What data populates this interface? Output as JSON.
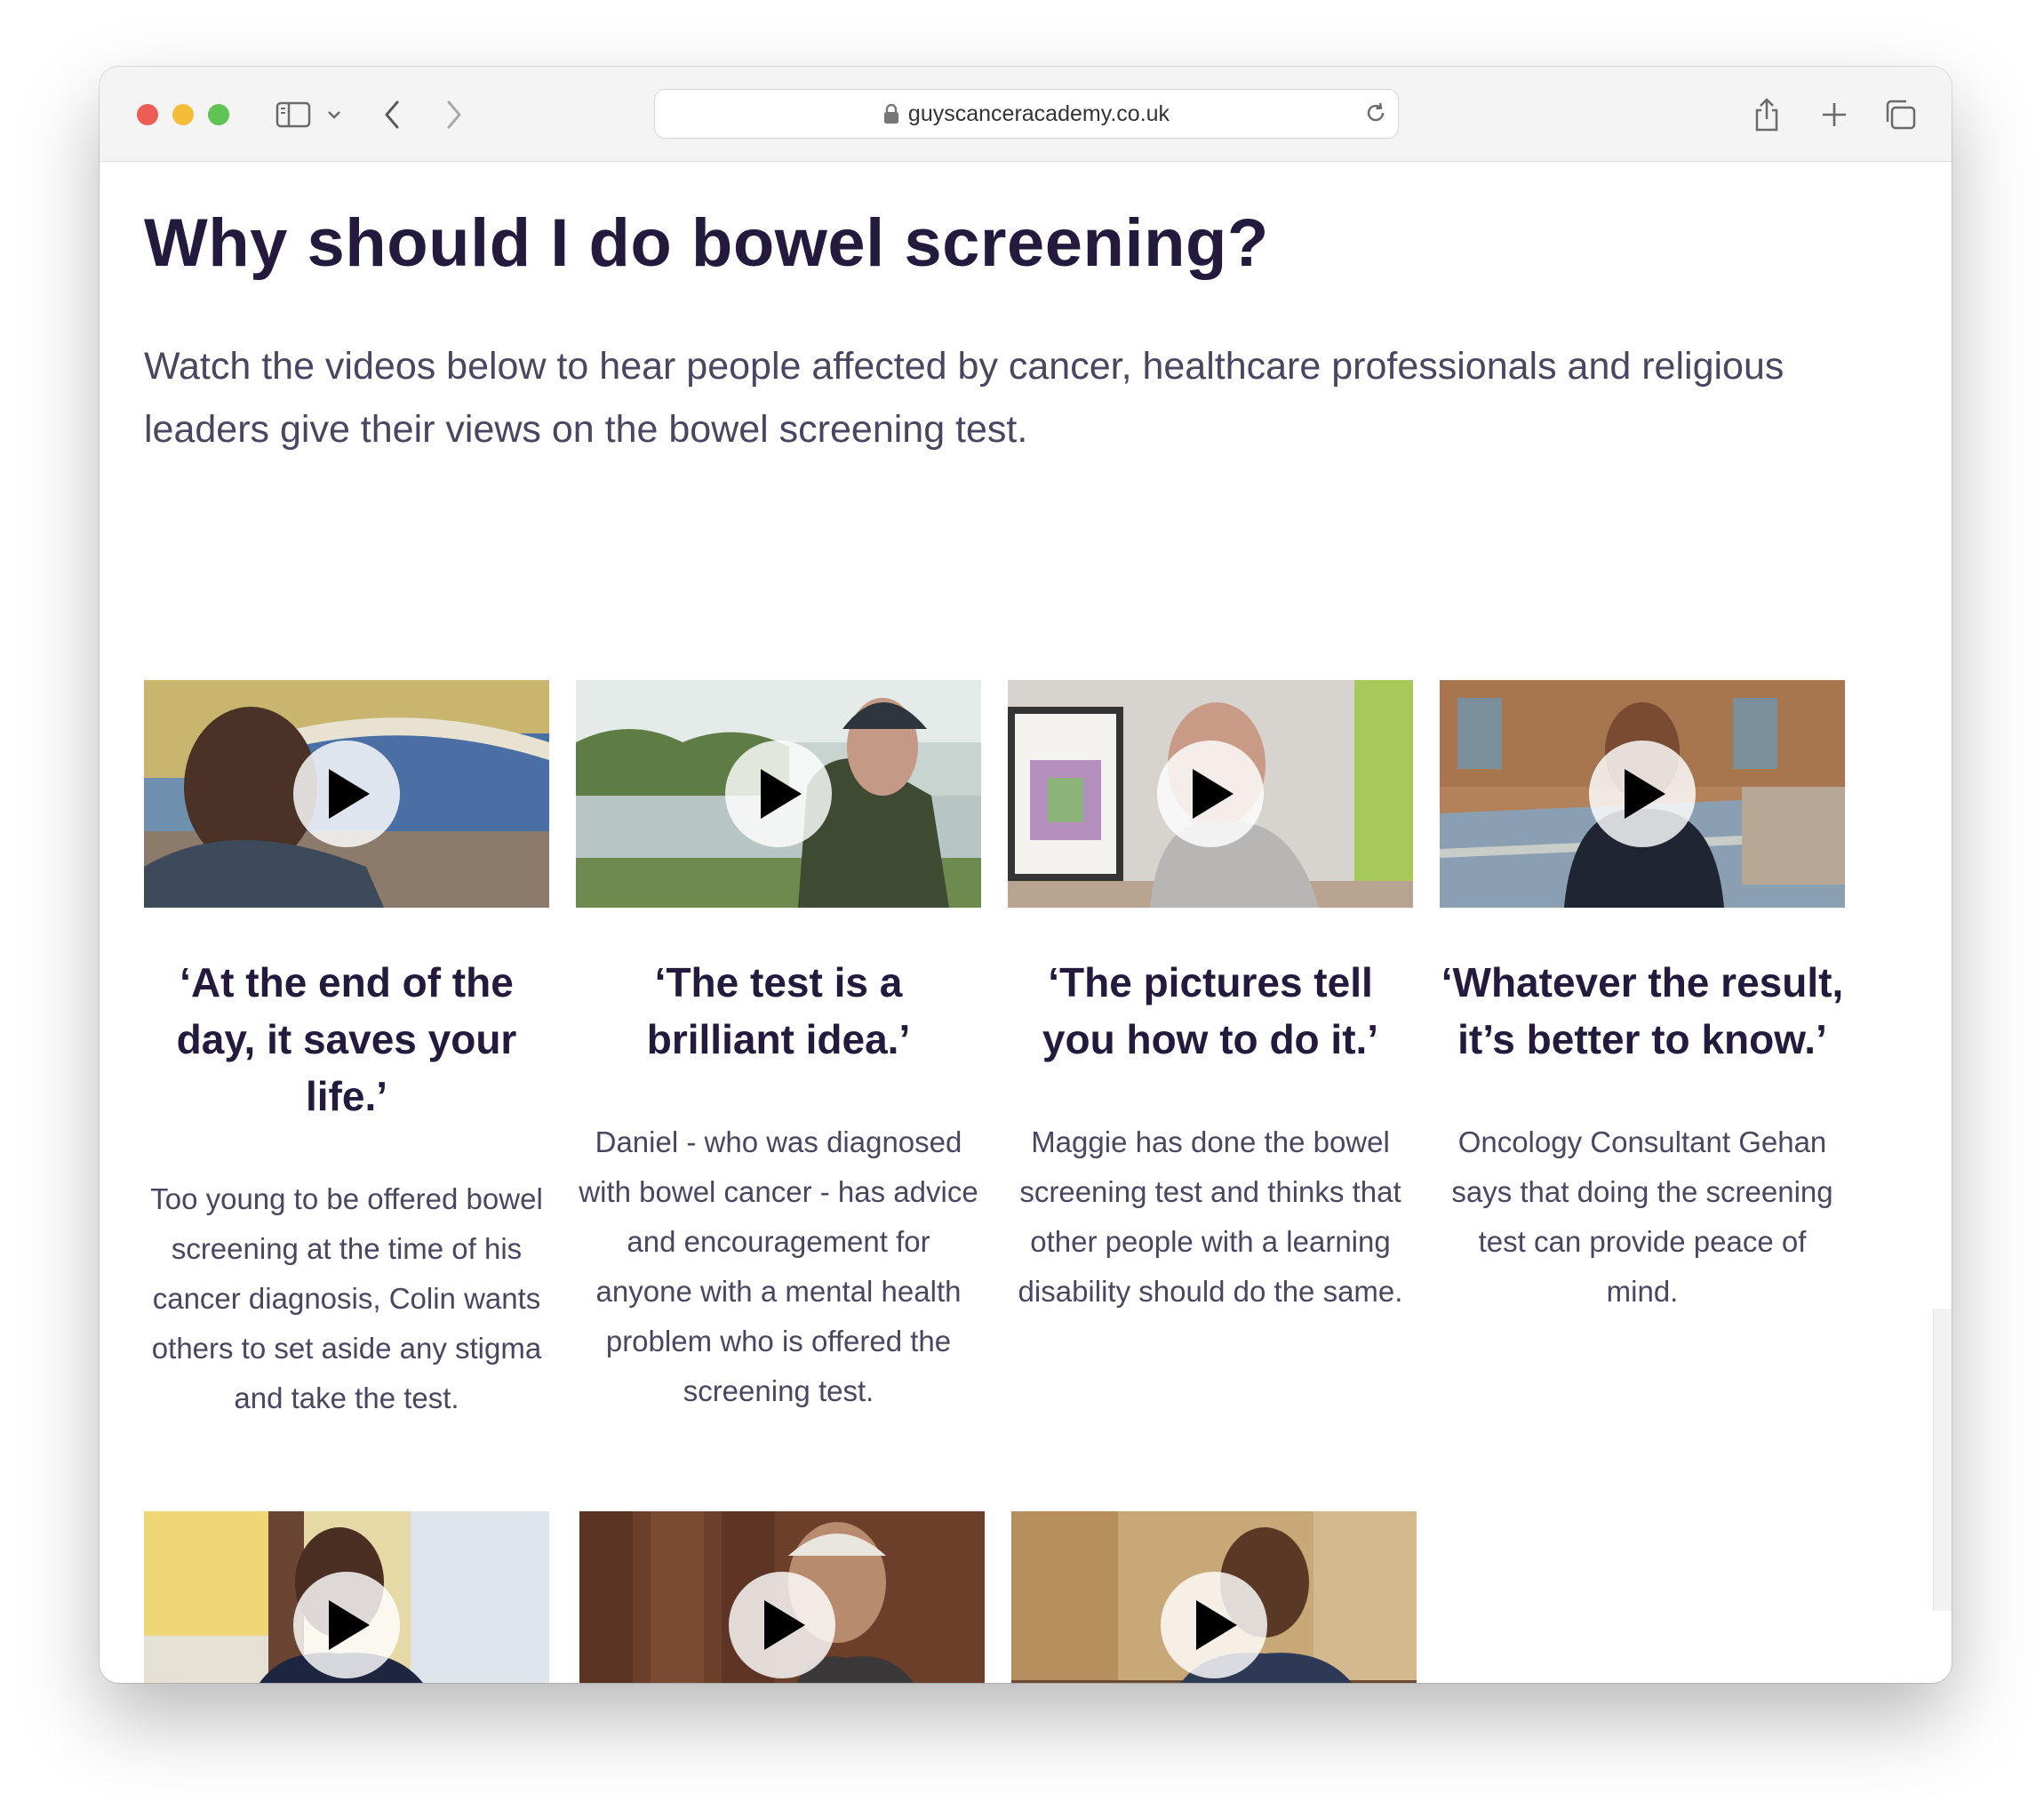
{
  "browser": {
    "url": "guyscanceracademy.co.uk"
  },
  "page": {
    "title": "Why should I do bowel screening?",
    "intro": "Watch the videos below to hear people affected by cancer, healthcare professionals and religious leaders give their views on the bowel screening test."
  },
  "videos": [
    {
      "quote": "‘At the end of the day, it saves your life.’",
      "description": "Too young to be offered bowel screening at the time of his cancer diagnosis, Colin wants others to set aside any stigma and take the test."
    },
    {
      "quote": "‘The test is a brilliant idea.’",
      "description": "Daniel - who was diagnosed with bowel cancer - has advice and encouragement for anyone with a mental health problem who is offered the screening test."
    },
    {
      "quote": "‘The pictures tell you how to do it.’",
      "description": "Maggie has done the bowel screening test and thinks that other people with a learning disability should do the same."
    },
    {
      "quote": "‘Whatever the result, it’s better to know.’",
      "description": "Oncology Consultant Gehan says that doing the screening test can provide peace of mind."
    }
  ],
  "icons": {
    "play": "play-icon",
    "lock": "lock-icon",
    "reload": "reload-icon",
    "share": "share-icon",
    "new_tab": "plus-icon",
    "tab_overview": "tabs-icon",
    "sidebar": "sidebar-icon",
    "back": "back-icon",
    "forward": "forward-icon"
  },
  "colors": {
    "heading": "#231a3d",
    "body_text": "#4a4561",
    "traffic_red": "#ee5d54",
    "traffic_yellow": "#f4bd39",
    "traffic_green": "#5fc454"
  }
}
